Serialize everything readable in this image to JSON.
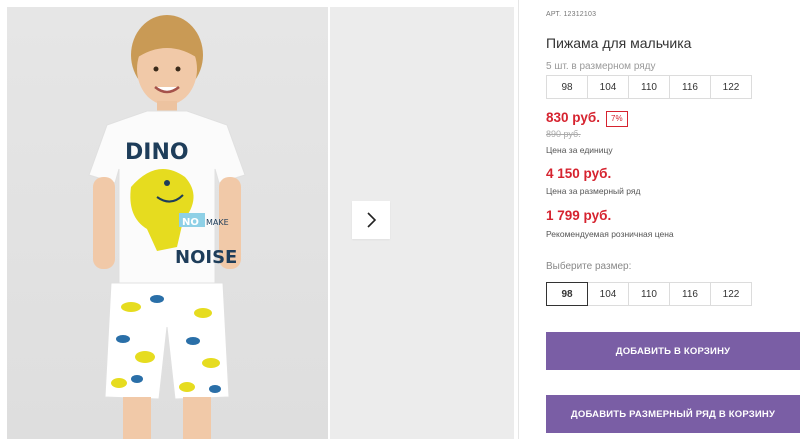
{
  "product": {
    "sku_label": "АРТ.",
    "sku_value": "12312103",
    "title": "Пижама для мальчика"
  },
  "gallery": {
    "photo_print": {
      "word1": "DINO",
      "word2": "NO",
      "word3": "NOISE",
      "word_small": "MAKE"
    },
    "next_icon": "chevron-right-icon"
  },
  "size_row": {
    "caption": "5 шт. в размерном ряду",
    "sizes": [
      "98",
      "104",
      "110",
      "116",
      "122"
    ]
  },
  "prices": {
    "unit_price": "830 руб.",
    "discount": "7%",
    "old_price": "890 руб.",
    "unit_caption": "Цена за единицу",
    "row_price": "4 150 руб.",
    "row_caption": "Цена за размерный ряд",
    "retail_price": "1 799 руб.",
    "retail_caption": "Рекомендуемая розничная цена"
  },
  "size_select": {
    "label": "Выберите размер:",
    "sizes": [
      "98",
      "104",
      "110",
      "116",
      "122"
    ],
    "selected": "98"
  },
  "buttons": {
    "add_to_cart": "ДОБАВИТЬ В КОРЗИНУ",
    "add_row_to_cart": "ДОБАВИТЬ РАЗМЕРНЫЙ РЯД В КОРЗИНУ"
  },
  "colors": {
    "accent": "#7a5ea5",
    "price_red": "#d6232f"
  }
}
